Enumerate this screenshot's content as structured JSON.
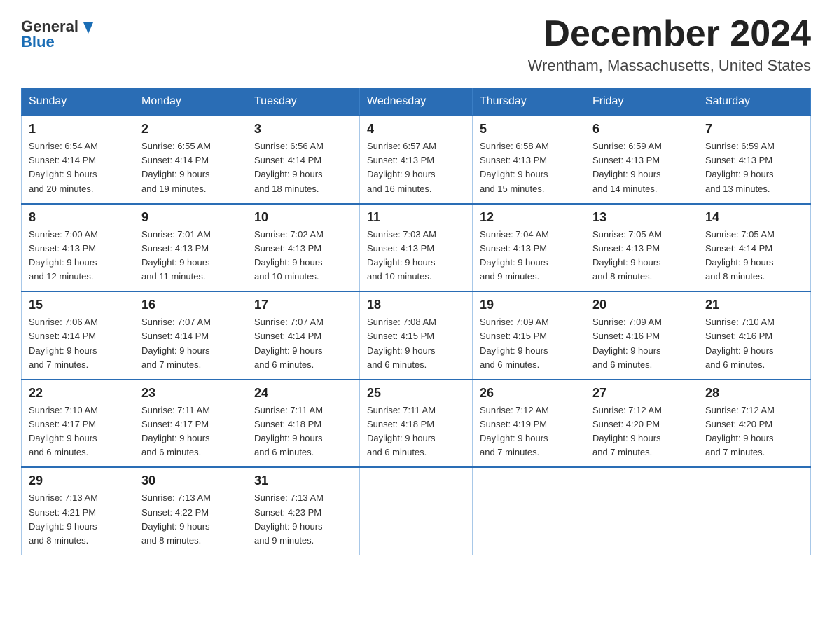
{
  "header": {
    "month_title": "December 2024",
    "location": "Wrentham, Massachusetts, United States",
    "logo_line1": "General",
    "logo_line2": "Blue"
  },
  "weekdays": [
    "Sunday",
    "Monday",
    "Tuesday",
    "Wednesday",
    "Thursday",
    "Friday",
    "Saturday"
  ],
  "weeks": [
    [
      {
        "day": "1",
        "sunrise": "6:54 AM",
        "sunset": "4:14 PM",
        "daylight": "9 hours and 20 minutes."
      },
      {
        "day": "2",
        "sunrise": "6:55 AM",
        "sunset": "4:14 PM",
        "daylight": "9 hours and 19 minutes."
      },
      {
        "day": "3",
        "sunrise": "6:56 AM",
        "sunset": "4:14 PM",
        "daylight": "9 hours and 18 minutes."
      },
      {
        "day": "4",
        "sunrise": "6:57 AM",
        "sunset": "4:13 PM",
        "daylight": "9 hours and 16 minutes."
      },
      {
        "day": "5",
        "sunrise": "6:58 AM",
        "sunset": "4:13 PM",
        "daylight": "9 hours and 15 minutes."
      },
      {
        "day": "6",
        "sunrise": "6:59 AM",
        "sunset": "4:13 PM",
        "daylight": "9 hours and 14 minutes."
      },
      {
        "day": "7",
        "sunrise": "6:59 AM",
        "sunset": "4:13 PM",
        "daylight": "9 hours and 13 minutes."
      }
    ],
    [
      {
        "day": "8",
        "sunrise": "7:00 AM",
        "sunset": "4:13 PM",
        "daylight": "9 hours and 12 minutes."
      },
      {
        "day": "9",
        "sunrise": "7:01 AM",
        "sunset": "4:13 PM",
        "daylight": "9 hours and 11 minutes."
      },
      {
        "day": "10",
        "sunrise": "7:02 AM",
        "sunset": "4:13 PM",
        "daylight": "9 hours and 10 minutes."
      },
      {
        "day": "11",
        "sunrise": "7:03 AM",
        "sunset": "4:13 PM",
        "daylight": "9 hours and 10 minutes."
      },
      {
        "day": "12",
        "sunrise": "7:04 AM",
        "sunset": "4:13 PM",
        "daylight": "9 hours and 9 minutes."
      },
      {
        "day": "13",
        "sunrise": "7:05 AM",
        "sunset": "4:13 PM",
        "daylight": "9 hours and 8 minutes."
      },
      {
        "day": "14",
        "sunrise": "7:05 AM",
        "sunset": "4:14 PM",
        "daylight": "9 hours and 8 minutes."
      }
    ],
    [
      {
        "day": "15",
        "sunrise": "7:06 AM",
        "sunset": "4:14 PM",
        "daylight": "9 hours and 7 minutes."
      },
      {
        "day": "16",
        "sunrise": "7:07 AM",
        "sunset": "4:14 PM",
        "daylight": "9 hours and 7 minutes."
      },
      {
        "day": "17",
        "sunrise": "7:07 AM",
        "sunset": "4:14 PM",
        "daylight": "9 hours and 6 minutes."
      },
      {
        "day": "18",
        "sunrise": "7:08 AM",
        "sunset": "4:15 PM",
        "daylight": "9 hours and 6 minutes."
      },
      {
        "day": "19",
        "sunrise": "7:09 AM",
        "sunset": "4:15 PM",
        "daylight": "9 hours and 6 minutes."
      },
      {
        "day": "20",
        "sunrise": "7:09 AM",
        "sunset": "4:16 PM",
        "daylight": "9 hours and 6 minutes."
      },
      {
        "day": "21",
        "sunrise": "7:10 AM",
        "sunset": "4:16 PM",
        "daylight": "9 hours and 6 minutes."
      }
    ],
    [
      {
        "day": "22",
        "sunrise": "7:10 AM",
        "sunset": "4:17 PM",
        "daylight": "9 hours and 6 minutes."
      },
      {
        "day": "23",
        "sunrise": "7:11 AM",
        "sunset": "4:17 PM",
        "daylight": "9 hours and 6 minutes."
      },
      {
        "day": "24",
        "sunrise": "7:11 AM",
        "sunset": "4:18 PM",
        "daylight": "9 hours and 6 minutes."
      },
      {
        "day": "25",
        "sunrise": "7:11 AM",
        "sunset": "4:18 PM",
        "daylight": "9 hours and 6 minutes."
      },
      {
        "day": "26",
        "sunrise": "7:12 AM",
        "sunset": "4:19 PM",
        "daylight": "9 hours and 7 minutes."
      },
      {
        "day": "27",
        "sunrise": "7:12 AM",
        "sunset": "4:20 PM",
        "daylight": "9 hours and 7 minutes."
      },
      {
        "day": "28",
        "sunrise": "7:12 AM",
        "sunset": "4:20 PM",
        "daylight": "9 hours and 7 minutes."
      }
    ],
    [
      {
        "day": "29",
        "sunrise": "7:13 AM",
        "sunset": "4:21 PM",
        "daylight": "9 hours and 8 minutes."
      },
      {
        "day": "30",
        "sunrise": "7:13 AM",
        "sunset": "4:22 PM",
        "daylight": "9 hours and 8 minutes."
      },
      {
        "day": "31",
        "sunrise": "7:13 AM",
        "sunset": "4:23 PM",
        "daylight": "9 hours and 9 minutes."
      },
      null,
      null,
      null,
      null
    ]
  ],
  "labels": {
    "sunrise": "Sunrise:",
    "sunset": "Sunset:",
    "daylight": "Daylight:"
  }
}
